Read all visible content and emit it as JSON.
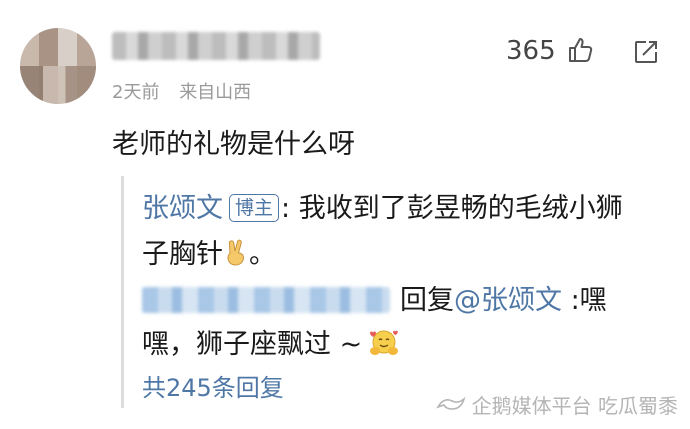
{
  "comment": {
    "time": "2天前",
    "location": "来自山西",
    "like_count": "365",
    "text": "老师的礼物是什么呀"
  },
  "reply": {
    "author": "张颂文",
    "badge": "博主",
    "text_line1": ": 我收到了彭昱畅的毛绒小狮",
    "text_line2": "子胸针",
    "text_line2_end": "。",
    "sub_reply_prefix": "回复",
    "sub_reply_target": "@张颂文",
    "sub_reply_text1": " :嘿",
    "sub_reply_text2": "嘿，狮子座飘过 ~",
    "more_replies": "共245条回复"
  },
  "watermark": {
    "text": "企鹅媒体平台 吃瓜蜀黍"
  },
  "colors": {
    "link_blue": "#4f77a6",
    "meta_gray": "#9a9a9a"
  },
  "icons": [
    "like-icon",
    "share-icon",
    "victory-hand-emoji",
    "hugging-emoji",
    "penguin-logo-icon"
  ]
}
